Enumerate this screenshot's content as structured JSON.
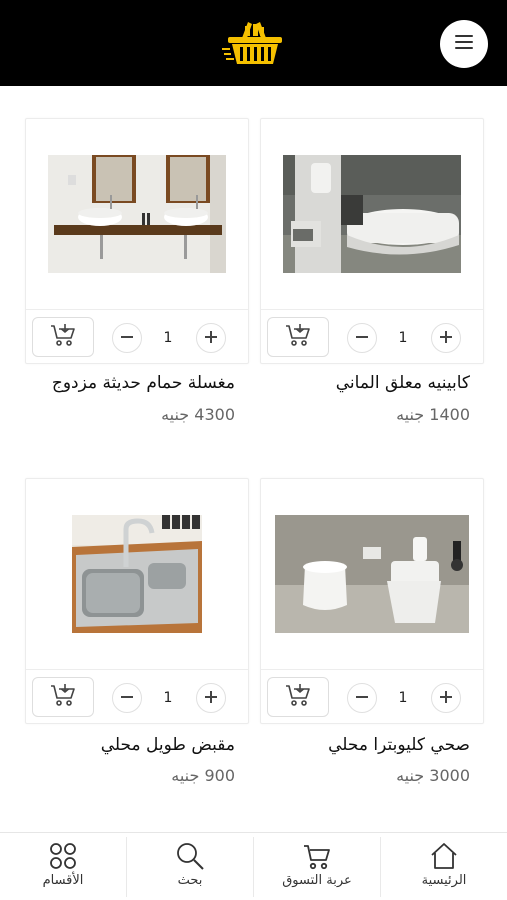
{
  "colors": {
    "header_bg": "#000000",
    "accent": "#F5C000"
  },
  "header": {
    "logo_icon": "shopping-basket-logo-icon",
    "menu_icon": "hamburger-menu-icon"
  },
  "products": [
    {
      "name": "كابينيه معلق الماني",
      "price": "1400 جنيه",
      "quantity": "1",
      "image": "toilet-cabinet-photo"
    },
    {
      "name": "مغسلة حمام حديثة مزدوج",
      "price": "4300 جنيه",
      "quantity": "1",
      "image": "double-sink-photo"
    },
    {
      "name": "صحي كليوبترا محلي",
      "price": "3000 جنيه",
      "quantity": "1",
      "image": "bidet-toilet-photo"
    },
    {
      "name": "مقبض طويل محلي",
      "price": "900 جنيه",
      "quantity": "1",
      "image": "kitchen-sink-photo"
    }
  ],
  "bottom_nav": [
    {
      "label": "الرئيسية",
      "icon": "home-icon"
    },
    {
      "label": "عربة التسوق",
      "icon": "cart-icon"
    },
    {
      "label": "بحث",
      "icon": "search-icon"
    },
    {
      "label": "الأقسام",
      "icon": "categories-icon"
    }
  ]
}
